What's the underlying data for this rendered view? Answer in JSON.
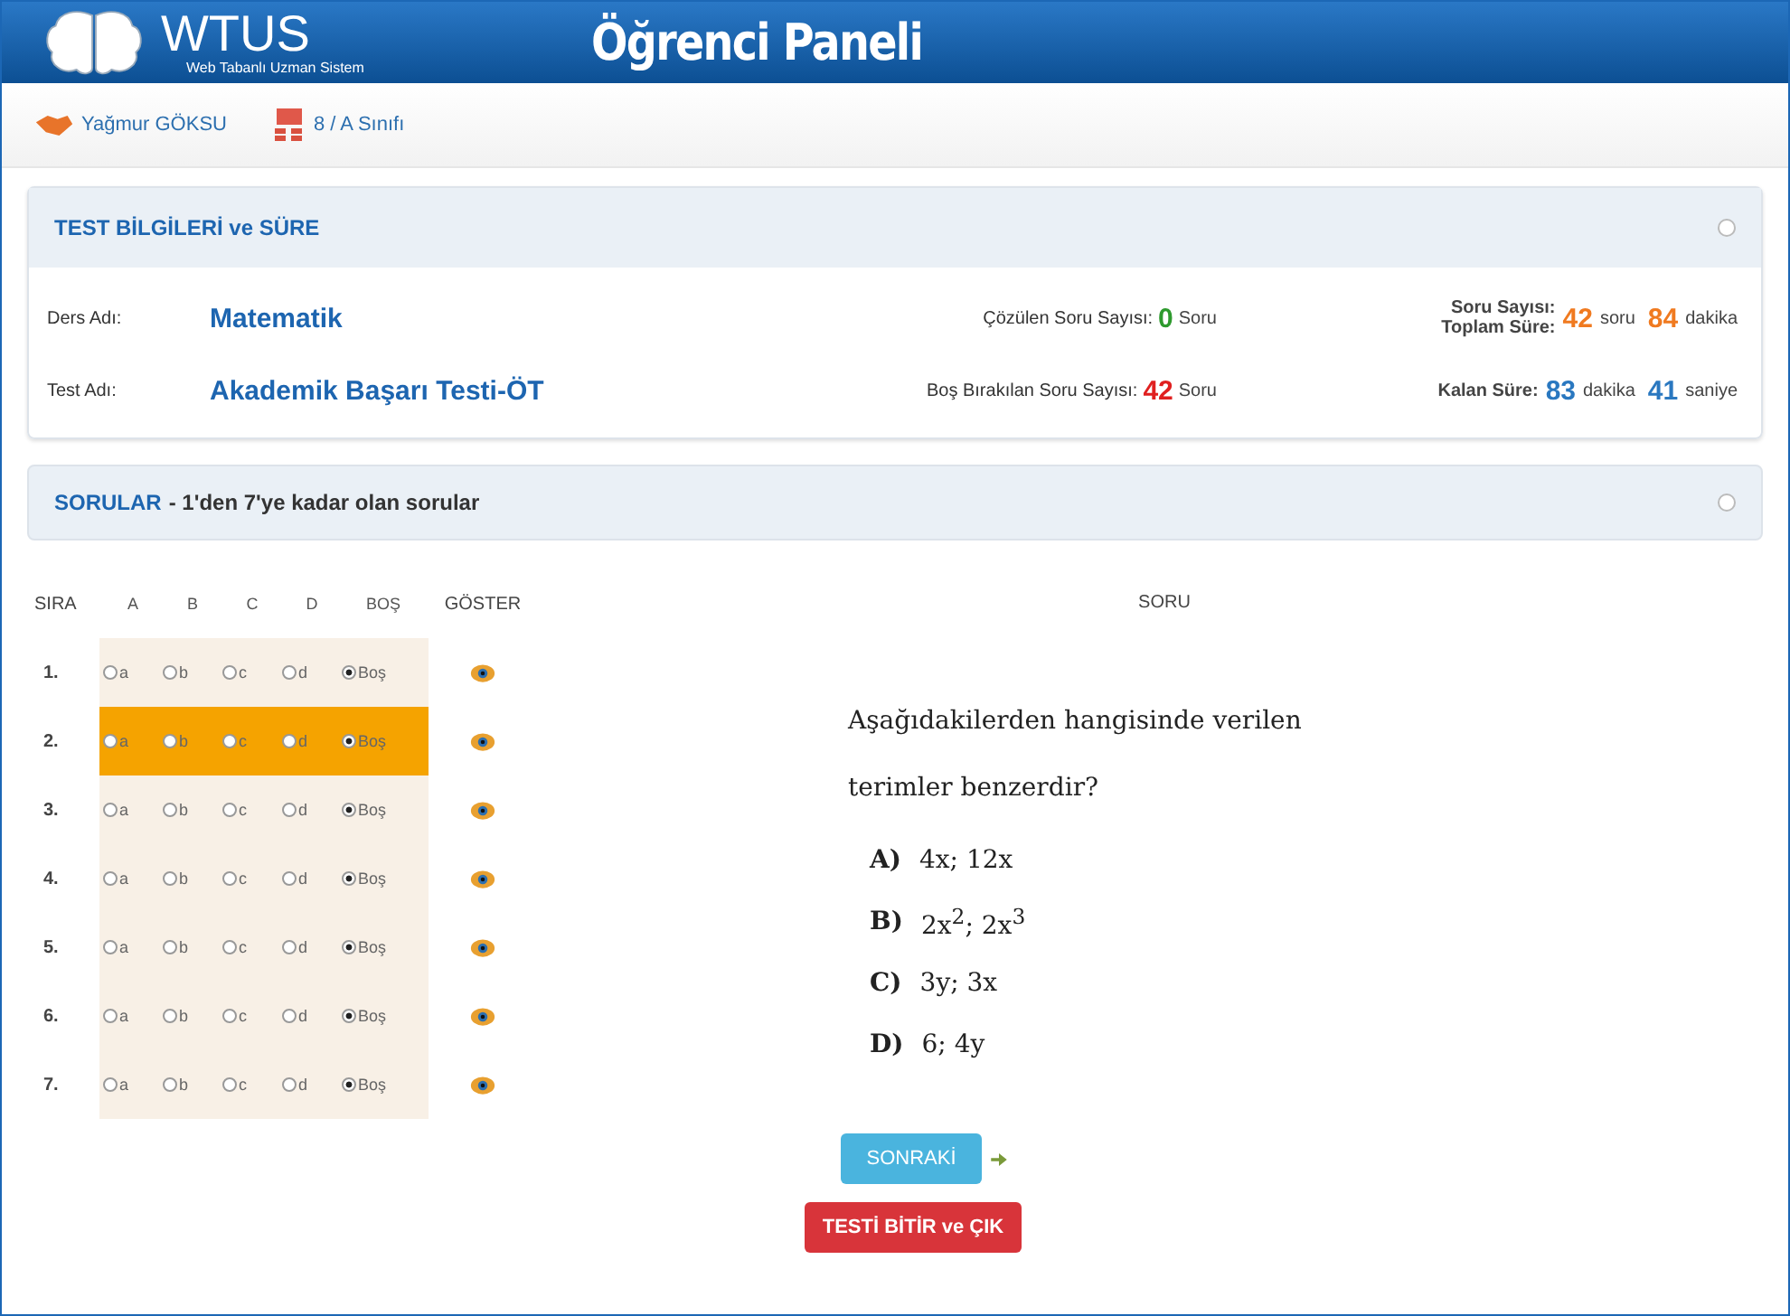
{
  "header": {
    "logo_title": "WTUS",
    "logo_subtitle": "Web Tabanlı Uzman Sistem",
    "title": "Öğrenci Paneli"
  },
  "user": {
    "name": "Yağmur GÖKSU",
    "class": "8 / A Sınıfı"
  },
  "info_panel": {
    "title": "TEST BİLGİLERİ ve SÜRE",
    "course_label": "Ders Adı:",
    "course": "Matematik",
    "test_label": "Test Adı:",
    "test": "Akademik Başarı Testi-ÖT",
    "solved_label": "Çözülen Soru Sayısı:",
    "solved": "0",
    "solved_unit": "Soru",
    "blank_label": "Boş Bırakılan Soru Sayısı:",
    "blank": "42",
    "blank_unit": "Soru",
    "count_label": "Soru Sayısı:",
    "total_label": "Toplam Süre:",
    "count": "42",
    "count_unit": "soru",
    "total": "84",
    "total_unit": "dakika",
    "remaining_label": "Kalan Süre:",
    "minutes": "83",
    "minutes_unit": "dakika",
    "seconds": "41",
    "seconds_unit": "saniye"
  },
  "questions_panel": {
    "title": "SORULAR",
    "subtitle": "- 1'den 7'ye kadar olan sorular"
  },
  "table": {
    "columns": [
      "SIRA",
      "A",
      "B",
      "C",
      "D",
      "BOŞ",
      "GÖSTER",
      "SORU"
    ],
    "rows": [
      {
        "number": "1.",
        "current": false,
        "options": [
          {
            "label": "a",
            "selected": false
          },
          {
            "label": "b",
            "selected": false
          },
          {
            "label": "c",
            "selected": false
          },
          {
            "label": "d",
            "selected": false
          },
          {
            "label": "Boş",
            "selected": true
          }
        ]
      },
      {
        "number": "2.",
        "current": true,
        "options": [
          {
            "label": "a",
            "selected": false
          },
          {
            "label": "b",
            "selected": false
          },
          {
            "label": "c",
            "selected": false
          },
          {
            "label": "d",
            "selected": false
          },
          {
            "label": "Boş",
            "selected": true
          }
        ]
      },
      {
        "number": "3.",
        "current": false,
        "options": [
          {
            "label": "a",
            "selected": false
          },
          {
            "label": "b",
            "selected": false
          },
          {
            "label": "c",
            "selected": false
          },
          {
            "label": "d",
            "selected": false
          },
          {
            "label": "Boş",
            "selected": true
          }
        ]
      },
      {
        "number": "4.",
        "current": false,
        "options": [
          {
            "label": "a",
            "selected": false
          },
          {
            "label": "b",
            "selected": false
          },
          {
            "label": "c",
            "selected": false
          },
          {
            "label": "d",
            "selected": false
          },
          {
            "label": "Boş",
            "selected": true
          }
        ]
      },
      {
        "number": "5.",
        "current": false,
        "options": [
          {
            "label": "a",
            "selected": false
          },
          {
            "label": "b",
            "selected": false
          },
          {
            "label": "c",
            "selected": false
          },
          {
            "label": "d",
            "selected": false
          },
          {
            "label": "Boş",
            "selected": true
          }
        ]
      },
      {
        "number": "6.",
        "current": false,
        "options": [
          {
            "label": "a",
            "selected": false
          },
          {
            "label": "b",
            "selected": false
          },
          {
            "label": "c",
            "selected": false
          },
          {
            "label": "d",
            "selected": false
          },
          {
            "label": "Boş",
            "selected": true
          }
        ]
      },
      {
        "number": "7.",
        "current": false,
        "options": [
          {
            "label": "a",
            "selected": false
          },
          {
            "label": "b",
            "selected": false
          },
          {
            "label": "c",
            "selected": false
          },
          {
            "label": "d",
            "selected": false
          },
          {
            "label": "Boş",
            "selected": true
          }
        ]
      }
    ]
  },
  "question": {
    "text": "Aşağıdakilerden hangisinde verilen terimler benzerdir?",
    "choices": [
      {
        "letter": "A)",
        "text": "4x; 12x"
      },
      {
        "letter": "B)",
        "text": "2x$^{2}$; 2x$^{3}$"
      },
      {
        "letter": "C)",
        "text": "3y; 3x"
      },
      {
        "letter": "D)",
        "text": "6; 4y"
      }
    ]
  },
  "buttons": {
    "next": "SONRAKİ",
    "finish": "TESTİ BİTİR ve ÇIK"
  }
}
